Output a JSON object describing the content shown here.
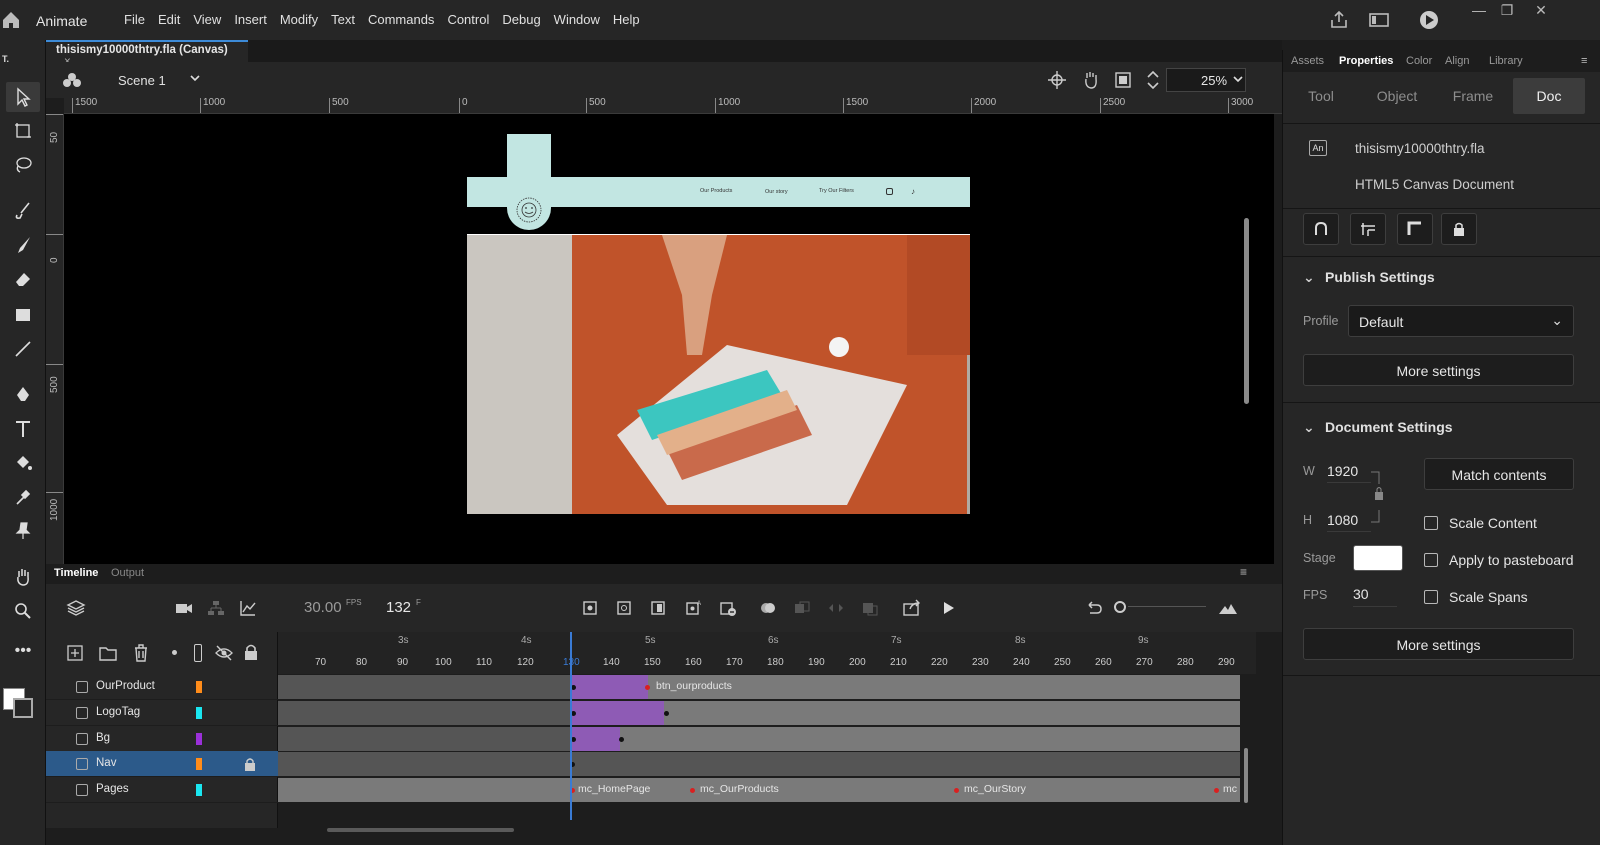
{
  "app": {
    "name": "Animate",
    "menus": [
      "File",
      "Edit",
      "View",
      "Insert",
      "Modify",
      "Text",
      "Commands",
      "Control",
      "Debug",
      "Window",
      "Help"
    ],
    "document_tab": "thisismy10000thtry.fla (Canvas)",
    "document_tab_close": "×"
  },
  "toolbar": {
    "top_label": "T."
  },
  "scene": {
    "label": "Scene 1",
    "zoom": "25%"
  },
  "rulers": {
    "horizontal": [
      "1500",
      "1000",
      "500",
      "0",
      "500",
      "1000",
      "1500",
      "2000",
      "2500",
      "3000"
    ],
    "vertical": [
      "50",
      "0",
      "500",
      "1000"
    ]
  },
  "stage": {
    "nav_links": [
      "Our Products",
      "Our story",
      "Try Our Filters"
    ]
  },
  "properties": {
    "tabs": [
      "Assets",
      "Properties",
      "Color",
      "Align",
      "Library"
    ],
    "active_tab": "Properties",
    "subtabs": [
      "Tool",
      "Object",
      "Frame",
      "Doc"
    ],
    "active_subtab": "Doc",
    "doc_icon_label": "An",
    "filename": "thisismy10000thtry.fla",
    "doc_type": "HTML5 Canvas Document",
    "publish": {
      "title": "Publish Settings",
      "profile_label": "Profile",
      "profile_value": "Default",
      "more_settings": "More settings"
    },
    "document": {
      "title": "Document Settings",
      "w_label": "W",
      "w_value": "1920",
      "h_label": "H",
      "h_value": "1080",
      "match_contents": "Match contents",
      "scale_content": "Scale Content",
      "apply_pasteboard": "Apply to pasteboard",
      "scale_spans": "Scale Spans",
      "stage_label": "Stage",
      "stage_color": "#ffffff",
      "fps_label": "FPS",
      "fps_value": "30",
      "more_settings": "More settings"
    }
  },
  "timeline": {
    "tabs": [
      "Timeline",
      "Output"
    ],
    "fps": "30.00",
    "fps_unit": "FPS",
    "current_frame": "132",
    "frame_unit": "F",
    "seconds": [
      "3s",
      "4s",
      "5s",
      "6s",
      "7s",
      "8s",
      "9s"
    ],
    "frame_numbers": [
      "70",
      "80",
      "90",
      "100",
      "110",
      "120",
      "130",
      "140",
      "150",
      "160",
      "170",
      "180",
      "190",
      "200",
      "210",
      "220",
      "230",
      "240",
      "250",
      "260",
      "270",
      "280",
      "290"
    ],
    "layers": [
      {
        "name": "OurProduct",
        "color": "#ff8c1a"
      },
      {
        "name": "LogoTag",
        "color": "#1ae6f0"
      },
      {
        "name": "Bg",
        "color": "#9b30d9"
      },
      {
        "name": "Nav",
        "color": "#ff8c1a"
      },
      {
        "name": "Pages",
        "color": "#1ae6f0"
      }
    ],
    "frame_labels": {
      "ourproduct": "btn_ourproducts",
      "pages_1": "mc_HomePage",
      "pages_2": "mc_OurProducts",
      "pages_3": "mc_OurStory",
      "pages_4": "mc"
    }
  },
  "colors": {
    "accent": "#3d8bd8",
    "tween": "#8e5bb5",
    "selected_layer": "#2c5a8a"
  }
}
